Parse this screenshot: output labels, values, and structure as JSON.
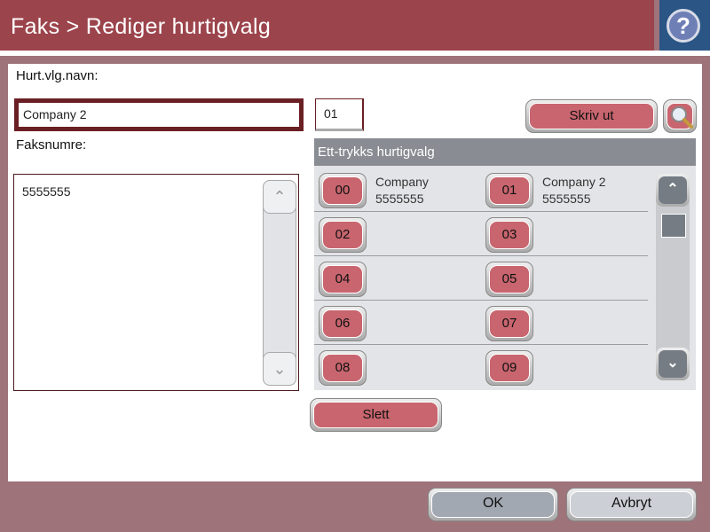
{
  "header": {
    "title": "Faks > Rediger hurtigvalg",
    "help_icon": "?"
  },
  "form": {
    "name_label": "Hurt.vlg.navn:",
    "name_value": "Company 2",
    "number_value": "01",
    "fax_label": "Faksnumre:",
    "fax_numbers": [
      "5555555"
    ]
  },
  "buttons": {
    "print": "Skriv ut",
    "delete": "Slett",
    "ok": "OK",
    "cancel": "Avbryt"
  },
  "speed_dial": {
    "title": "Ett-trykks hurtigvalg",
    "rows": [
      [
        {
          "num": "00",
          "name": "Company",
          "fax": "5555555"
        },
        {
          "num": "01",
          "name": "Company 2",
          "fax": "5555555"
        }
      ],
      [
        {
          "num": "02",
          "name": "",
          "fax": ""
        },
        {
          "num": "03",
          "name": "",
          "fax": ""
        }
      ],
      [
        {
          "num": "04",
          "name": "",
          "fax": ""
        },
        {
          "num": "05",
          "name": "",
          "fax": ""
        }
      ],
      [
        {
          "num": "06",
          "name": "",
          "fax": ""
        },
        {
          "num": "07",
          "name": "",
          "fax": ""
        }
      ],
      [
        {
          "num": "08",
          "name": "",
          "fax": ""
        },
        {
          "num": "09",
          "name": "",
          "fax": ""
        }
      ]
    ]
  },
  "icons": {
    "up": "^",
    "down": "v"
  }
}
